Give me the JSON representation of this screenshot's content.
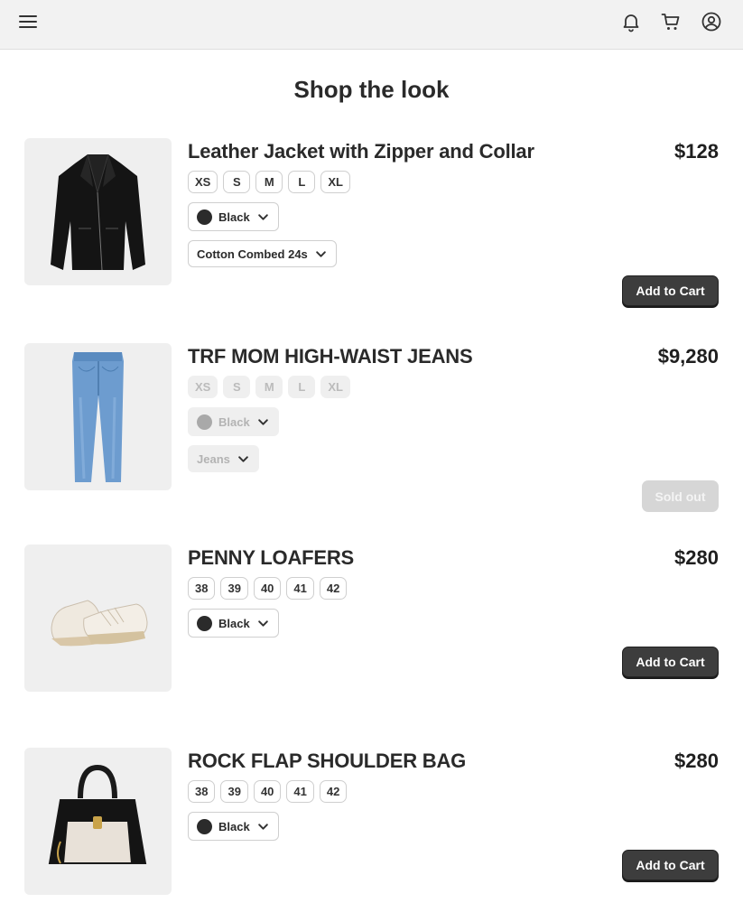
{
  "header": {
    "menu_icon": "hamburger-menu-icon",
    "actions": [
      "bell-icon",
      "cart-icon",
      "user-account-icon"
    ]
  },
  "page": {
    "title": "Shop the look"
  },
  "colors": {
    "button_bg": "#3d3d3d",
    "disabled_bg": "#d6d6d6",
    "thumb_bg": "#efefef",
    "header_bg": "#f2f2f2"
  },
  "products": [
    {
      "name": "Leather Jacket with Zipper and Collar",
      "price": "$128",
      "sizes": [
        "XS",
        "S",
        "M",
        "L",
        "XL"
      ],
      "color": "Black",
      "material": "Cotton Combed 24s",
      "action": "Add to Cart",
      "image": "leather-jacket"
    },
    {
      "name": "TRF MOM HIGH-WAIST JEANS",
      "price": "$9,280",
      "sizes": [
        "XS",
        "S",
        "M",
        "L",
        "XL"
      ],
      "color": "Black",
      "material": "Jeans",
      "action": "Sold out",
      "sold_out": true,
      "image": "jeans"
    },
    {
      "name": "PENNY LOAFERS",
      "price": "$280",
      "sizes": [
        "38",
        "39",
        "40",
        "41",
        "42"
      ],
      "color": "Black",
      "action": "Add to Cart",
      "image": "sneakers"
    },
    {
      "name": "ROCK FLAP SHOULDER BAG",
      "price": "$280",
      "sizes": [
        "38",
        "39",
        "40",
        "41",
        "42"
      ],
      "color": "Black",
      "action": "Add to Cart",
      "image": "handbag"
    }
  ]
}
